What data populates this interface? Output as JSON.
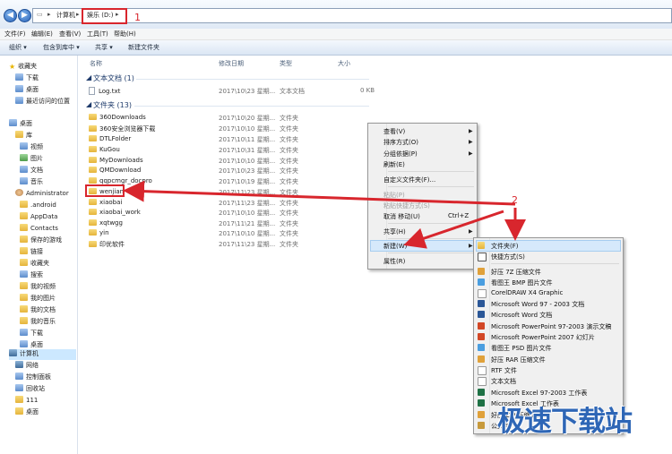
{
  "address": {
    "crumbs": [
      "计算机",
      "娱乐 (D:)"
    ],
    "annotation": "1"
  },
  "menubar": [
    "文件(F)",
    "编辑(E)",
    "查看(V)",
    "工具(T)",
    "帮助(H)"
  ],
  "toolbar": [
    "组织 ▾",
    "包含到库中 ▾",
    "共享 ▾",
    "新建文件夹"
  ],
  "nav": {
    "favorites": [
      "收藏夹",
      "下载",
      "桌面",
      "最近访问的位置"
    ],
    "desktop": "桌面",
    "libraries": [
      "库",
      "视频",
      "图片",
      "文档",
      "音乐"
    ],
    "user": "Administrator",
    "user_items": [
      ".android",
      "AppData",
      "Contacts",
      "保存的游戏",
      "链接",
      "收藏夹",
      "搜索",
      "我的视频",
      "我的图片",
      "我的文档",
      "我的音乐",
      "下载",
      "桌面"
    ],
    "other": [
      "计算机",
      "网络",
      "控制面板",
      "回收站",
      "111",
      "桌面"
    ]
  },
  "columns": [
    "名称",
    "修改日期",
    "类型",
    "大小"
  ],
  "groups": {
    "text_docs": "文本文档 (1)",
    "folders": "文件夹 (13)"
  },
  "text_files": [
    {
      "name": "Log.txt",
      "date": "2017\\10\\23 星期...",
      "type": "文本文档",
      "size": "0 KB"
    }
  ],
  "folders": [
    {
      "name": "360Downloads",
      "date": "2017\\10\\20 星期...",
      "type": "文件夹"
    },
    {
      "name": "360安全浏览器下载",
      "date": "2017\\10\\10 星期...",
      "type": "文件夹"
    },
    {
      "name": "DTLFolder",
      "date": "2017\\10\\11 星期...",
      "type": "文件夹"
    },
    {
      "name": "KuGou",
      "date": "2017\\10\\31 星期...",
      "type": "文件夹"
    },
    {
      "name": "MyDownloads",
      "date": "2017\\10\\10 星期...",
      "type": "文件夹"
    },
    {
      "name": "QMDownload",
      "date": "2017\\10\\23 星期...",
      "type": "文件夹"
    },
    {
      "name": "qqpcmgr_docpro",
      "date": "2017\\10\\19 星期...",
      "type": "文件夹"
    },
    {
      "name": "wenjian",
      "date": "2017\\11\\23 星期...",
      "type": "文件夹"
    },
    {
      "name": "xiaobai",
      "date": "2017\\11\\23 星期...",
      "type": "文件夹"
    },
    {
      "name": "xiaobai_work",
      "date": "2017\\10\\10 星期...",
      "type": "文件夹"
    },
    {
      "name": "xqtwgg",
      "date": "2017\\11\\21 星期...",
      "type": "文件夹"
    },
    {
      "name": "yin",
      "date": "2017\\10\\10 星期...",
      "type": "文件夹"
    },
    {
      "name": "印优软件",
      "date": "2017\\11\\23 星期...",
      "type": "文件夹"
    }
  ],
  "context_menu": {
    "view": "查看(V)",
    "sort": "排序方式(O)",
    "group": "分组依据(P)",
    "refresh": "刷新(E)",
    "customize": "自定义文件夹(F)...",
    "paste": "粘贴(P)",
    "paste_shortcut": "粘贴快捷方式(S)",
    "undo": "取消 移动(U)",
    "undo_shortcut": "Ctrl+Z",
    "share": "共享(H)",
    "new": "新建(W)",
    "properties": "属性(R)",
    "annotation": "2"
  },
  "new_submenu": [
    "文件夹(F)",
    "快捷方式(S)",
    "好压 7Z 压缩文件",
    "看图王 BMP 图片文件",
    "CorelDRAW X4 Graphic",
    "Microsoft Word 97 - 2003 文档",
    "Microsoft Word 文档",
    "Microsoft PowerPoint 97-2003 演示文稿",
    "Microsoft PowerPoint 2007 幻灯片",
    "看图王 PSD 图片文件",
    "好压 RAR 压缩文件",
    "RTF 文件",
    "文本文档",
    "Microsoft Excel 97-2003 工作表",
    "Microsoft Excel 工作表",
    "好压 ZIP 压缩文件",
    "公文包"
  ],
  "watermark": "极速下载站",
  "colors": {
    "annotation_red": "#d8262d",
    "folder_yellow": "#f0c75a",
    "highlight_blue": "#d6e9fb",
    "watermark_blue": "#2e66b6"
  }
}
